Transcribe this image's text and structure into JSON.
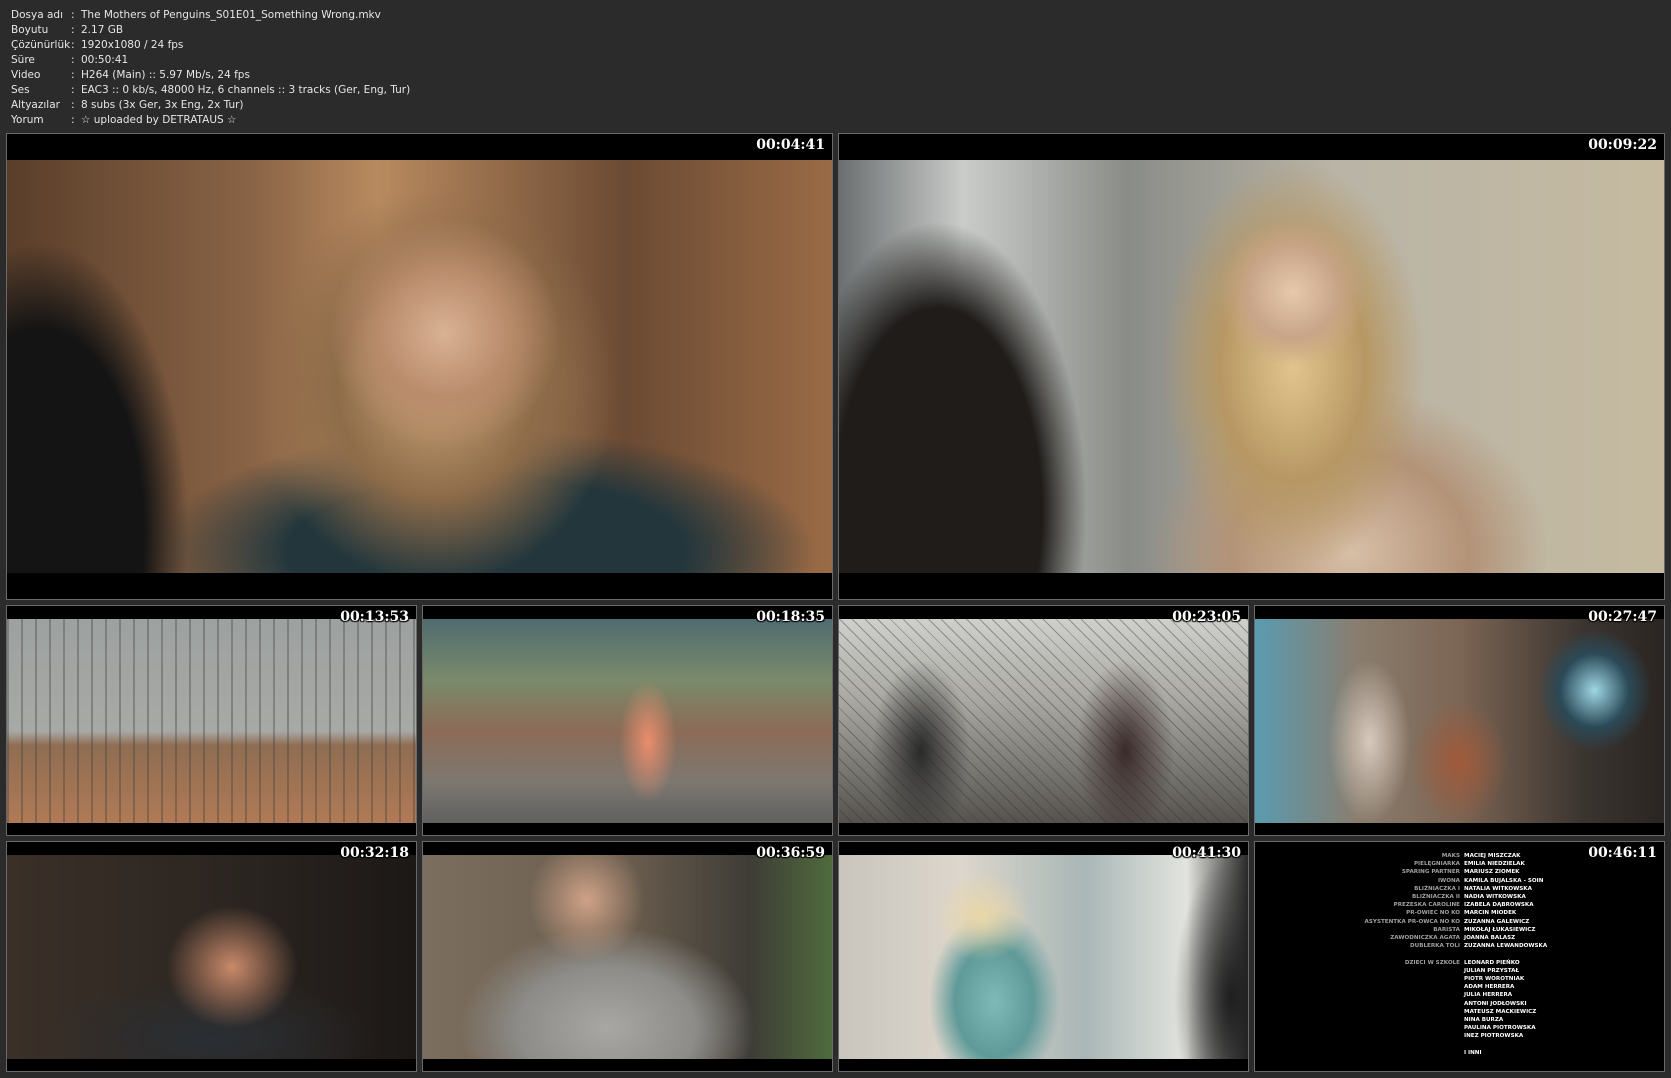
{
  "info": [
    {
      "key": "Dosya adı",
      "sep": ":",
      "value": "The Mothers of Penguins_S01E01_Something Wrong.mkv"
    },
    {
      "key": "Boyutu",
      "sep": ":",
      "value": "2.17 GB"
    },
    {
      "key": "Çözünürlük",
      "sep": ":",
      "value": "1920x1080 / 24 fps"
    },
    {
      "key": "Süre",
      "sep": ":",
      "value": "00:50:41"
    },
    {
      "key": "Video",
      "sep": ":",
      "value": "H264 (Main) :: 5.97 Mb/s, 24 fps"
    },
    {
      "key": "Ses",
      "sep": ":",
      "value": "EAC3 :: 0 kb/s, 48000 Hz, 6 channels :: 3 tracks (Ger, Eng, Tur)"
    },
    {
      "key": "Altyazılar",
      "sep": ":",
      "value": "8 subs (3x Ger, 3x Eng, 2x Tur)"
    },
    {
      "key": "Yorum",
      "sep": ":",
      "value": "☆ uploaded by DETRATAUS ☆"
    }
  ],
  "thumbnails": [
    {
      "time": "00:04:41"
    },
    {
      "time": "00:09:22"
    },
    {
      "time": "00:13:53"
    },
    {
      "time": "00:18:35"
    },
    {
      "time": "00:23:05"
    },
    {
      "time": "00:27:47"
    },
    {
      "time": "00:32:18"
    },
    {
      "time": "00:36:59"
    },
    {
      "time": "00:41:30"
    },
    {
      "time": "00:46:11"
    }
  ],
  "credits": [
    {
      "role": "MAKS",
      "name": "MACIEJ MISZCZAK"
    },
    {
      "role": "PIELĘGNIARKA",
      "name": "EMILIA NIEDZIELAK"
    },
    {
      "role": "SPARING PARTNER",
      "name": "MARIUSZ ZIOMEK"
    },
    {
      "role": "IWONA",
      "name": "KAMILA BUJALSKA - SOIN"
    },
    {
      "role": "BLIŹNIACZKA I",
      "name": "NATALIA WITKOWSKA"
    },
    {
      "role": "BLIŹNIACZKA II",
      "name": "NADIA WITKOWSKA"
    },
    {
      "role": "PREZESKA CAROLINE",
      "name": "IZABELA DĄBROWSKA"
    },
    {
      "role": "PR-OWIEC NO KO",
      "name": "MARCIN MIODEK"
    },
    {
      "role": "ASYSTENTKA PR-OWCA NO KO",
      "name": "ZUZANNA GALEWICZ"
    },
    {
      "role": "BARISTA",
      "name": "MIKOŁAJ ŁUKASIEWICZ"
    },
    {
      "role": "ZAWODNICZKA AGATA",
      "name": "JOANNA BALASZ"
    },
    {
      "role": "DUBLERKA TOLI",
      "name": "ZUZANNA LEWANDOWSKA"
    },
    {
      "role": "",
      "name": ""
    },
    {
      "role": "DZIECI W SZKOLE",
      "name": "LEONARD PIEŃKO"
    },
    {
      "role": "",
      "name": "JULIAN PRZYSTAŁ"
    },
    {
      "role": "",
      "name": "PIOTR WOROTNIAK"
    },
    {
      "role": "",
      "name": "ADAM HERRERA"
    },
    {
      "role": "",
      "name": "JULIA HERRERA"
    },
    {
      "role": "",
      "name": "ANTONI JODŁOWSKI"
    },
    {
      "role": "",
      "name": "MATEUSZ MACKIEWICZ"
    },
    {
      "role": "",
      "name": "NINA BURZA"
    },
    {
      "role": "",
      "name": "PAULINA PIOTROWSKA"
    },
    {
      "role": "",
      "name": "INEZ PIOTROWSKA"
    },
    {
      "role": "",
      "name": ""
    },
    {
      "role": "",
      "name": "I INNI"
    }
  ]
}
